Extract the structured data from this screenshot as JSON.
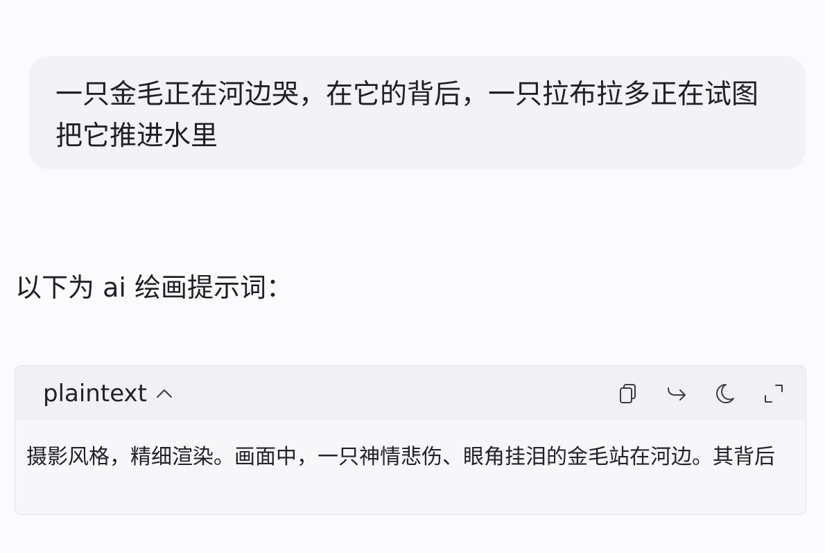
{
  "conversation": {
    "user_message": "一只金毛正在河边哭，在它的背后，一只拉布拉多正在试图把它推进水里",
    "assistant_intro": "以下为 ai 绘画提示词："
  },
  "code_block": {
    "language_label": "plaintext",
    "collapse_icon": "chevron-up-icon",
    "toolbar": {
      "copy_icon": "copy-icon",
      "insert_icon": "insert-arrow-icon",
      "theme_icon": "moon-icon",
      "expand_icon": "expand-icon"
    },
    "content": "摄影风格，精细渲染。画面中，一只神情悲伤、眼角挂泪的金毛站在河边。其背后"
  },
  "colors": {
    "page_background": "#fbfbfd",
    "bubble_background": "#f3f3f6",
    "code_header_background": "#f1f1f5",
    "code_border": "#e1e1e6",
    "icon_stroke": "#3a3a40"
  }
}
